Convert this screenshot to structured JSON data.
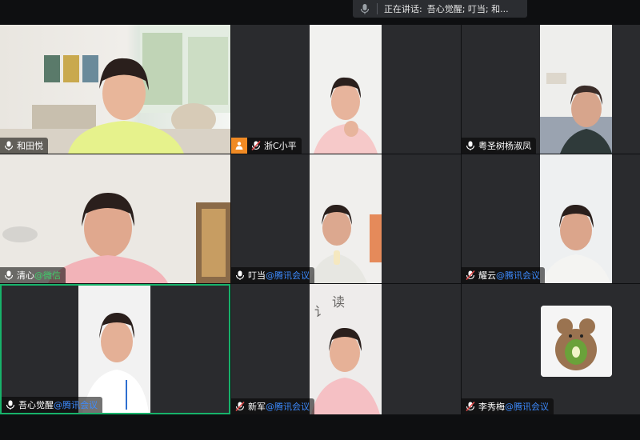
{
  "speaking_bar": {
    "label": "正在讲话:",
    "names": "吾心觉醒; 叮当; 和..."
  },
  "participants": [
    {
      "name": "和田悦",
      "suffix": "",
      "suffix_type": "",
      "mic": "on",
      "host": false
    },
    {
      "name": "浙C小平",
      "suffix": "",
      "suffix_type": "",
      "mic": "muted",
      "host": true
    },
    {
      "name": "粤圣树杨淑凤",
      "suffix": "",
      "suffix_type": "",
      "mic": "on",
      "host": false
    },
    {
      "name": "清心",
      "suffix": "@微信",
      "suffix_type": "wechat",
      "mic": "on",
      "host": false
    },
    {
      "name": "叮当",
      "suffix": "@腾讯会议",
      "suffix_type": "tencent",
      "mic": "on",
      "host": false
    },
    {
      "name": "耀云",
      "suffix": "@腾讯会议",
      "suffix_type": "tencent",
      "mic": "muted",
      "host": false
    },
    {
      "name": "吾心觉醒",
      "suffix": "@腾讯会议",
      "suffix_type": "tencent",
      "mic": "on",
      "host": false
    },
    {
      "name": "新军",
      "suffix": "@腾讯会议",
      "suffix_type": "tencent",
      "mic": "muted",
      "host": false
    },
    {
      "name": "李秀梅",
      "suffix": "@腾讯会议",
      "suffix_type": "tencent",
      "mic": "muted",
      "host": false
    }
  ],
  "colors": {
    "active_border": "#17b36b",
    "tencent_link": "#3d8bff",
    "wechat_link": "#3fcf6a",
    "host_badge": "#f08a24",
    "muted_mic": "#e04848"
  }
}
